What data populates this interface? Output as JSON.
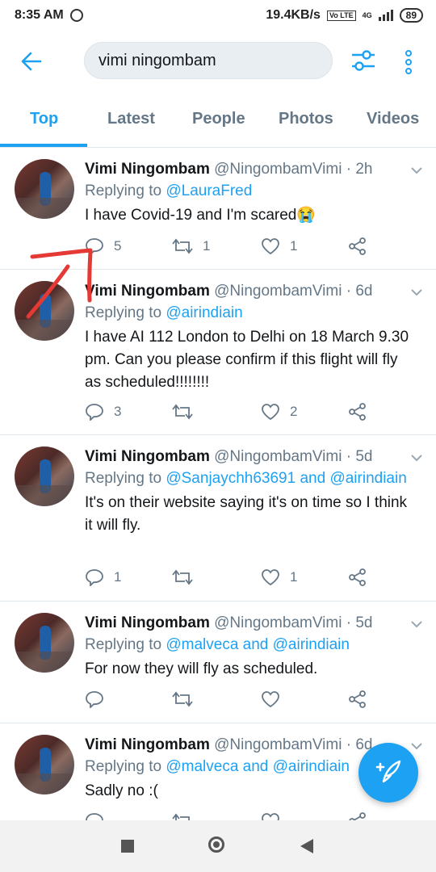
{
  "status_bar": {
    "time": "8:35 AM",
    "net_speed": "19.4KB/s",
    "volte": "Vo LTE",
    "network": "4G",
    "battery": "89"
  },
  "search": {
    "query": "vimi ningombam"
  },
  "tabs": [
    {
      "label": "Top",
      "active": true
    },
    {
      "label": "Latest"
    },
    {
      "label": "People"
    },
    {
      "label": "Photos"
    },
    {
      "label": "Videos"
    }
  ],
  "tweets": [
    {
      "name": "Vimi Ningombam",
      "handle": "@NingombamVimi",
      "sep": "·",
      "time": "2h",
      "reply_prefix": "Replying to",
      "reply_to": "@LauraFred",
      "text": "I have Covid-19 and I'm scared😭",
      "replies": "5",
      "retweets": "1",
      "likes": "1"
    },
    {
      "name": "Vimi Ningombam",
      "handle": "@NingombamVimi",
      "sep": "·",
      "time": "6d",
      "reply_prefix": "Replying to",
      "reply_to": "@airindiain",
      "text": "I have AI 112 London to Delhi on 18 March 9.30 pm. Can you please confirm if this flight will fly as scheduled!!!!!!!!",
      "replies": "3",
      "retweets": "",
      "likes": "2"
    },
    {
      "name": "Vimi Ningombam",
      "handle": "@NingombamVimi",
      "sep": "·",
      "time": "5d",
      "reply_prefix": "Replying to",
      "reply_to": "@Sanjaychh63691 and @airindiain",
      "text": "It's on their website saying it's on time so I think it will fly.",
      "replies": "1",
      "retweets": "",
      "likes": "1"
    },
    {
      "name": "Vimi Ningombam",
      "handle": "@NingombamVimi",
      "sep": "·",
      "time": "5d",
      "reply_prefix": "Replying to",
      "reply_to": "@malveca and @airindiain",
      "text": "For now they will fly as scheduled.",
      "replies": "",
      "retweets": "",
      "likes": ""
    },
    {
      "name": "Vimi Ningombam",
      "handle": "@NingombamVimi",
      "sep": "·",
      "time": "6d",
      "reply_prefix": "Replying to",
      "reply_to": "@malveca and @airindiain",
      "text": "Sadly no :(",
      "replies": "",
      "retweets": "",
      "likes": ""
    }
  ],
  "colors": {
    "accent": "#1da1f2",
    "annotation": "#e53935"
  }
}
